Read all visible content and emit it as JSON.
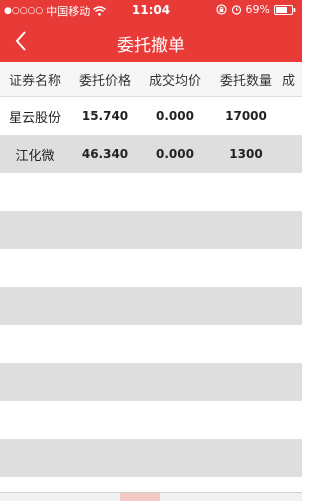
{
  "status": {
    "carrier": "中国移动",
    "time": "11:04",
    "battery": "69%"
  },
  "nav": {
    "title": "委托撤单"
  },
  "columns": [
    "证券名称",
    "委托价格",
    "成交均价",
    "委托数量",
    "成"
  ],
  "orders": [
    {
      "name": "星云股份",
      "order_price": "15.740",
      "avg_price": "0.000",
      "quantity": "17000"
    },
    {
      "name": "江化微",
      "order_price": "46.340",
      "avg_price": "0.000",
      "quantity": "1300"
    }
  ],
  "colors": {
    "accent": "#e83a36",
    "row_shade": "#dedede"
  },
  "icons": [
    "signal-dots-icon",
    "wifi-icon",
    "lock-rotation-icon",
    "alarm-icon",
    "battery-icon",
    "back-arrow-icon"
  ]
}
